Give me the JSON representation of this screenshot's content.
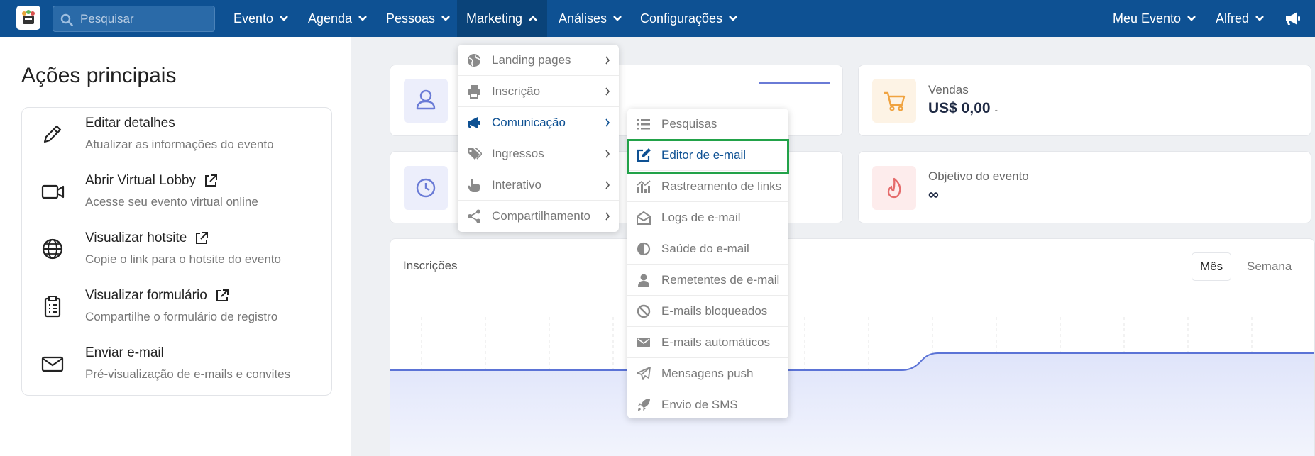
{
  "topbar": {
    "search_placeholder": "Pesquisar",
    "nav": [
      "Evento",
      "Agenda",
      "Pessoas",
      "Marketing",
      "Análises",
      "Configurações"
    ],
    "right": [
      "Meu Evento",
      "Alfred"
    ],
    "active": "Marketing"
  },
  "left": {
    "title": "Ações principais",
    "actions": [
      {
        "title": "Editar detalhes",
        "desc": "Atualizar as informações do evento",
        "icon": "pencil-icon",
        "external": false
      },
      {
        "title": "Abrir Virtual Lobby",
        "desc": "Acesse seu evento virtual online",
        "icon": "video-camera-icon",
        "external": true
      },
      {
        "title": "Visualizar hotsite",
        "desc": "Copie o link para o hotsite do evento",
        "icon": "globe-icon",
        "external": true
      },
      {
        "title": "Visualizar formulário",
        "desc": "Compartilhe o formulário de registro",
        "icon": "clipboard-icon",
        "external": true
      },
      {
        "title": "Enviar e-mail",
        "desc": "Pré-visualização de e-mails e convites",
        "icon": "envelope-icon",
        "external": false
      }
    ]
  },
  "stats": {
    "vendas_label": "Vendas",
    "vendas_value": "US$ 0,00",
    "vendas_delta": "-",
    "objetivo_label": "Objetivo do evento",
    "objetivo_value": "∞"
  },
  "chart": {
    "title": "Inscrições",
    "toggle_selected": "Mês",
    "toggle_other": "Semana",
    "line_color": "#5b73d6"
  },
  "marketing_menu": [
    {
      "label": "Landing pages",
      "icon": "globe-icon"
    },
    {
      "label": "Inscrição",
      "icon": "printer-icon"
    },
    {
      "label": "Comunicação",
      "icon": "megaphone-icon"
    },
    {
      "label": "Ingressos",
      "icon": "tags-icon"
    },
    {
      "label": "Interativo",
      "icon": "hand-pointer-icon"
    },
    {
      "label": "Compartilhamento",
      "icon": "share-icon"
    }
  ],
  "comunicacao_menu": [
    {
      "label": "Pesquisas",
      "icon": "list-icon"
    },
    {
      "label": "Editor de e-mail",
      "icon": "edit-icon"
    },
    {
      "label": "Rastreamento de links",
      "icon": "bar-chart-icon"
    },
    {
      "label": "Logs de e-mail",
      "icon": "envelope-open-icon"
    },
    {
      "label": "Saúde do e-mail",
      "icon": "half-circle-icon"
    },
    {
      "label": "Remetentes de e-mail",
      "icon": "user-icon"
    },
    {
      "label": "E-mails bloqueados",
      "icon": "ban-icon"
    },
    {
      "label": "E-mails automáticos",
      "icon": "envelope-icon"
    },
    {
      "label": "Mensagens push",
      "icon": "paper-plane-icon"
    },
    {
      "label": "Envio de SMS",
      "icon": "rocket-icon"
    }
  ],
  "colors": {
    "topbar": "#0e5193",
    "highlight_box": "#22a249",
    "menu_active": "#0e5193"
  }
}
